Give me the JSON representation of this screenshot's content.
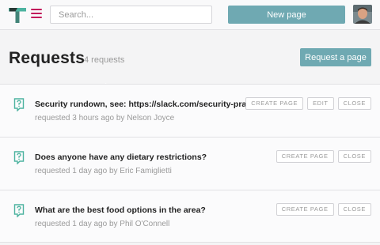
{
  "colors": {
    "accent": "#6fa9b2",
    "menu": "#c2185b",
    "icon_green": "#4db3a0"
  },
  "topbar": {
    "search_placeholder": "Search...",
    "new_page_label": "New page"
  },
  "header": {
    "title": "Requests",
    "count": "4 requests",
    "request_button_label": "Request a page"
  },
  "requests": [
    {
      "title": "Security rundown, see: https://slack.com/security-practices",
      "meta": "requested 3 hours ago by Nelson Joyce",
      "actions": [
        "CREATE PAGE",
        "EDIT",
        "CLOSE"
      ]
    },
    {
      "title": "Does anyone have any dietary restrictions?",
      "meta": "requested 1 day ago by Eric Famiglietti",
      "actions": [
        "CREATE PAGE",
        "CLOSE"
      ]
    },
    {
      "title": "What are the best food options in the area?",
      "meta": "requested 1 day ago by Phil O'Connell",
      "actions": [
        "CREATE PAGE",
        "CLOSE"
      ]
    }
  ]
}
